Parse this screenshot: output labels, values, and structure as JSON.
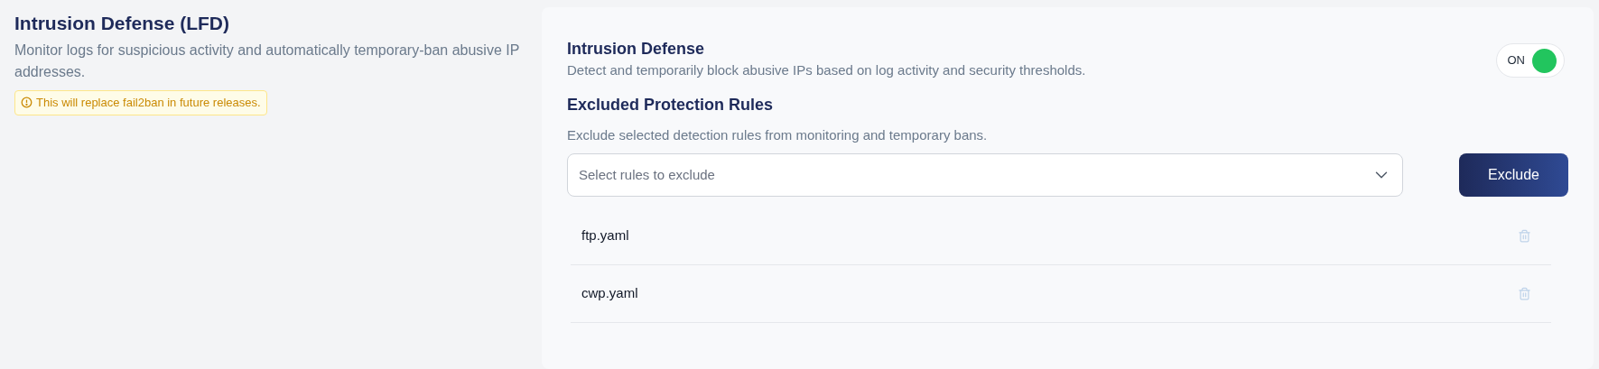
{
  "intro": {
    "title": "Intrusion Defense (LFD)",
    "description": "Monitor logs for suspicious activity and automatically temporary-ban abusive IP addresses.",
    "notice": "This will replace fail2ban in future releases."
  },
  "setting": {
    "title": "Intrusion Defense",
    "description": "Detect and temporarily block abusive IPs based on log activity and security thresholds.",
    "toggle": {
      "label": "ON",
      "on": true
    }
  },
  "exclusions": {
    "title": "Excluded Protection Rules",
    "description": "Exclude selected detection rules from monitoring and temporary bans.",
    "select": {
      "placeholder": "Select rules to exclude"
    },
    "button": "Exclude",
    "rules": [
      {
        "name": "ftp.yaml"
      },
      {
        "name": "cwp.yaml"
      }
    ]
  }
}
